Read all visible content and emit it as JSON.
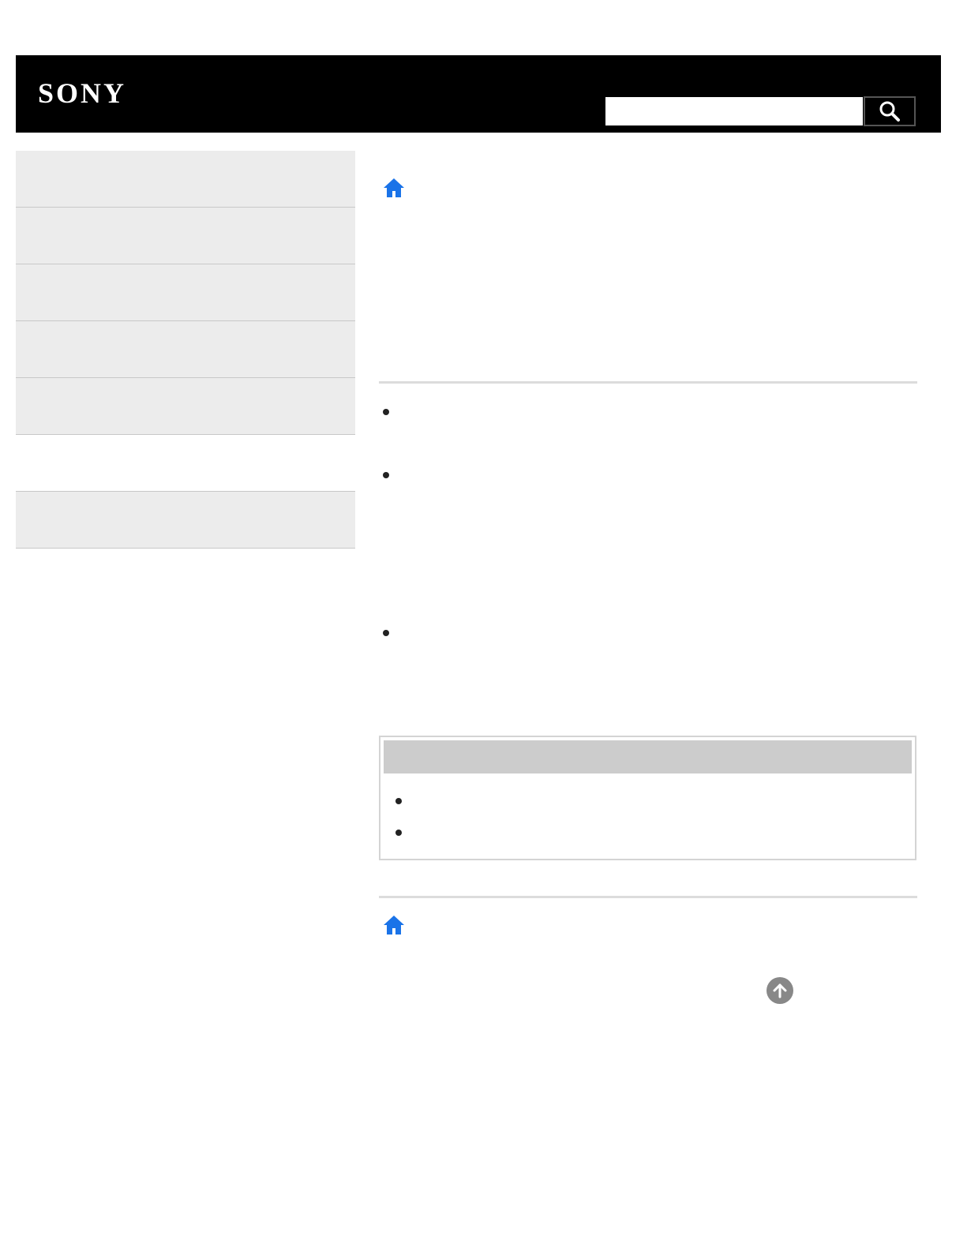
{
  "header": {
    "logo_text": "SONY",
    "search": {
      "value": "",
      "placeholder": ""
    },
    "search_button_icon": "search-icon"
  },
  "sidebar": {
    "items": [
      {
        "label": ""
      },
      {
        "label": ""
      },
      {
        "label": ""
      },
      {
        "label": ""
      },
      {
        "label": ""
      },
      {
        "label": ""
      },
      {
        "label": ""
      }
    ]
  },
  "main": {
    "home_icon": "home-icon",
    "bullets": [
      "",
      "",
      ""
    ],
    "related": {
      "title": "",
      "items": [
        "",
        ""
      ]
    },
    "back_to_top_icon": "arrow-up-circle-icon"
  },
  "colors": {
    "header_bg": "#000000",
    "home_icon": "#1a73e8",
    "sidebar_item_bg": "#ececec",
    "related_header_bg": "#cccccc",
    "back_to_top_bg": "#888888"
  }
}
